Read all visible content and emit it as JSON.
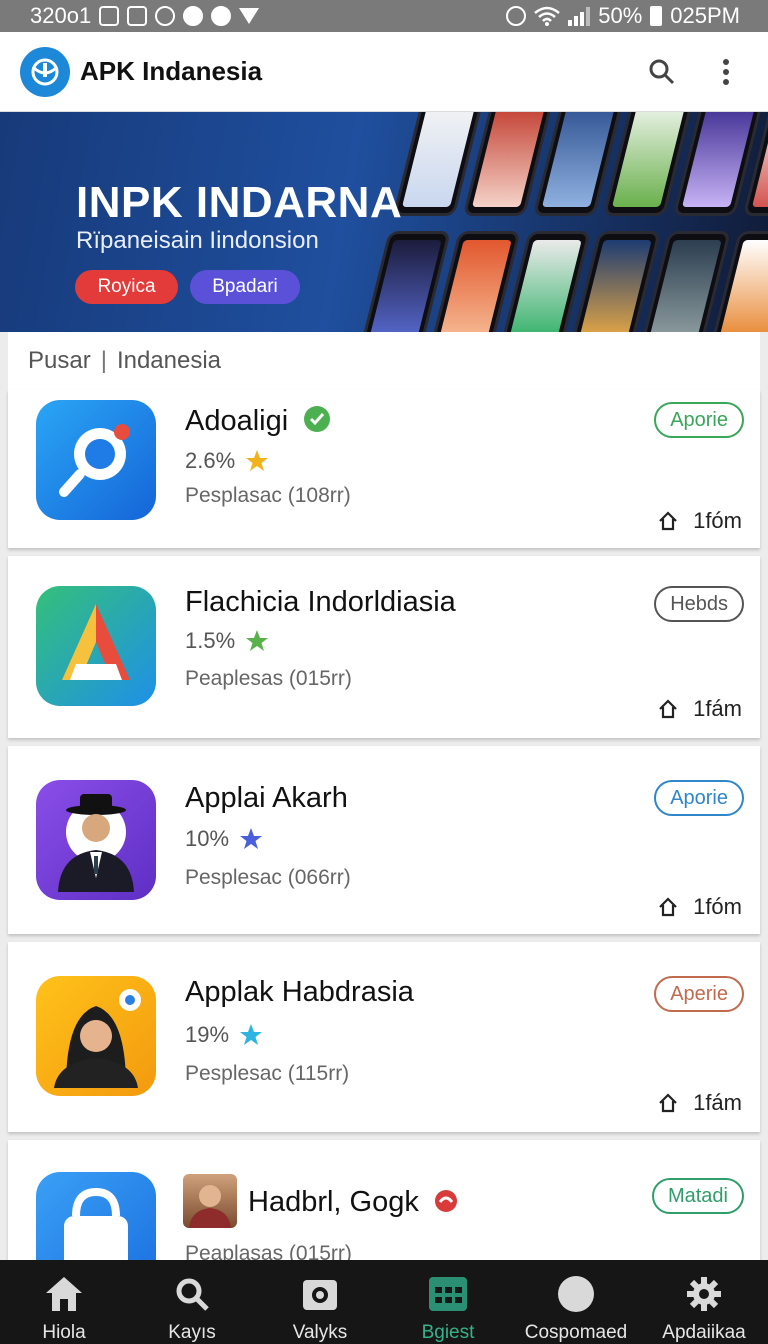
{
  "status": {
    "time_left": "320o1",
    "battery": "50%",
    "clock": "025PM"
  },
  "appbar": {
    "title": "APK Indanesia",
    "search_icon": "search-icon",
    "more_icon": "more-vert-icon"
  },
  "banner": {
    "title": "INPK INDARNA",
    "subtitle": "Rïpaneisain Iindonsion",
    "button_primary": "Royica",
    "button_secondary": "Bpadari"
  },
  "section": {
    "breadcrumb_1": "Pusar",
    "separator": "|",
    "breadcrumb_2": "Indanesia"
  },
  "apps": [
    {
      "name": "Adoaligi",
      "rating": "2.6%",
      "desc": "Pesplasac (108rr)",
      "action": "Aporie",
      "size": "1fóm",
      "action_color": "#3aa65a",
      "star_color": "#f2b21c"
    },
    {
      "name": "Flachicia Indorldiasia",
      "rating": "1.5%",
      "desc": "Peaplesas (015rr)",
      "action": "Hebds",
      "size": "1fám",
      "action_color": "#555555",
      "star_color": "#5ab04a"
    },
    {
      "name": "Applai Akarh",
      "rating": "10%",
      "desc": "Pesplesac (066rr)",
      "action": "Aporie",
      "size": "1fóm",
      "action_color": "#2f86c8",
      "star_color": "#4a5fdb"
    },
    {
      "name": "Applak Habdrasia",
      "rating": "19%",
      "desc": "Pesplesac (115rr)",
      "action": "Aperie",
      "size": "1fám",
      "action_color": "#c06a4e",
      "star_color": "#2db4e0"
    },
    {
      "name": "Hadbrl, Gogk",
      "rating": "",
      "desc": "Peaplasas (015rr)",
      "action": "Matadi",
      "size": "",
      "action_color": "#2f9e6a",
      "star_color": ""
    }
  ],
  "bottomnav": [
    {
      "label": "Hiola",
      "icon": "home-icon"
    },
    {
      "label": "Kayıs",
      "icon": "search-icon"
    },
    {
      "label": "Valyks",
      "icon": "camera-icon"
    },
    {
      "label": "Bgiest",
      "icon": "grid-icon",
      "active": true
    },
    {
      "label": "Cospomaed",
      "icon": "circle-icon"
    },
    {
      "label": "Apdaiikaa",
      "icon": "settings-icon"
    }
  ]
}
